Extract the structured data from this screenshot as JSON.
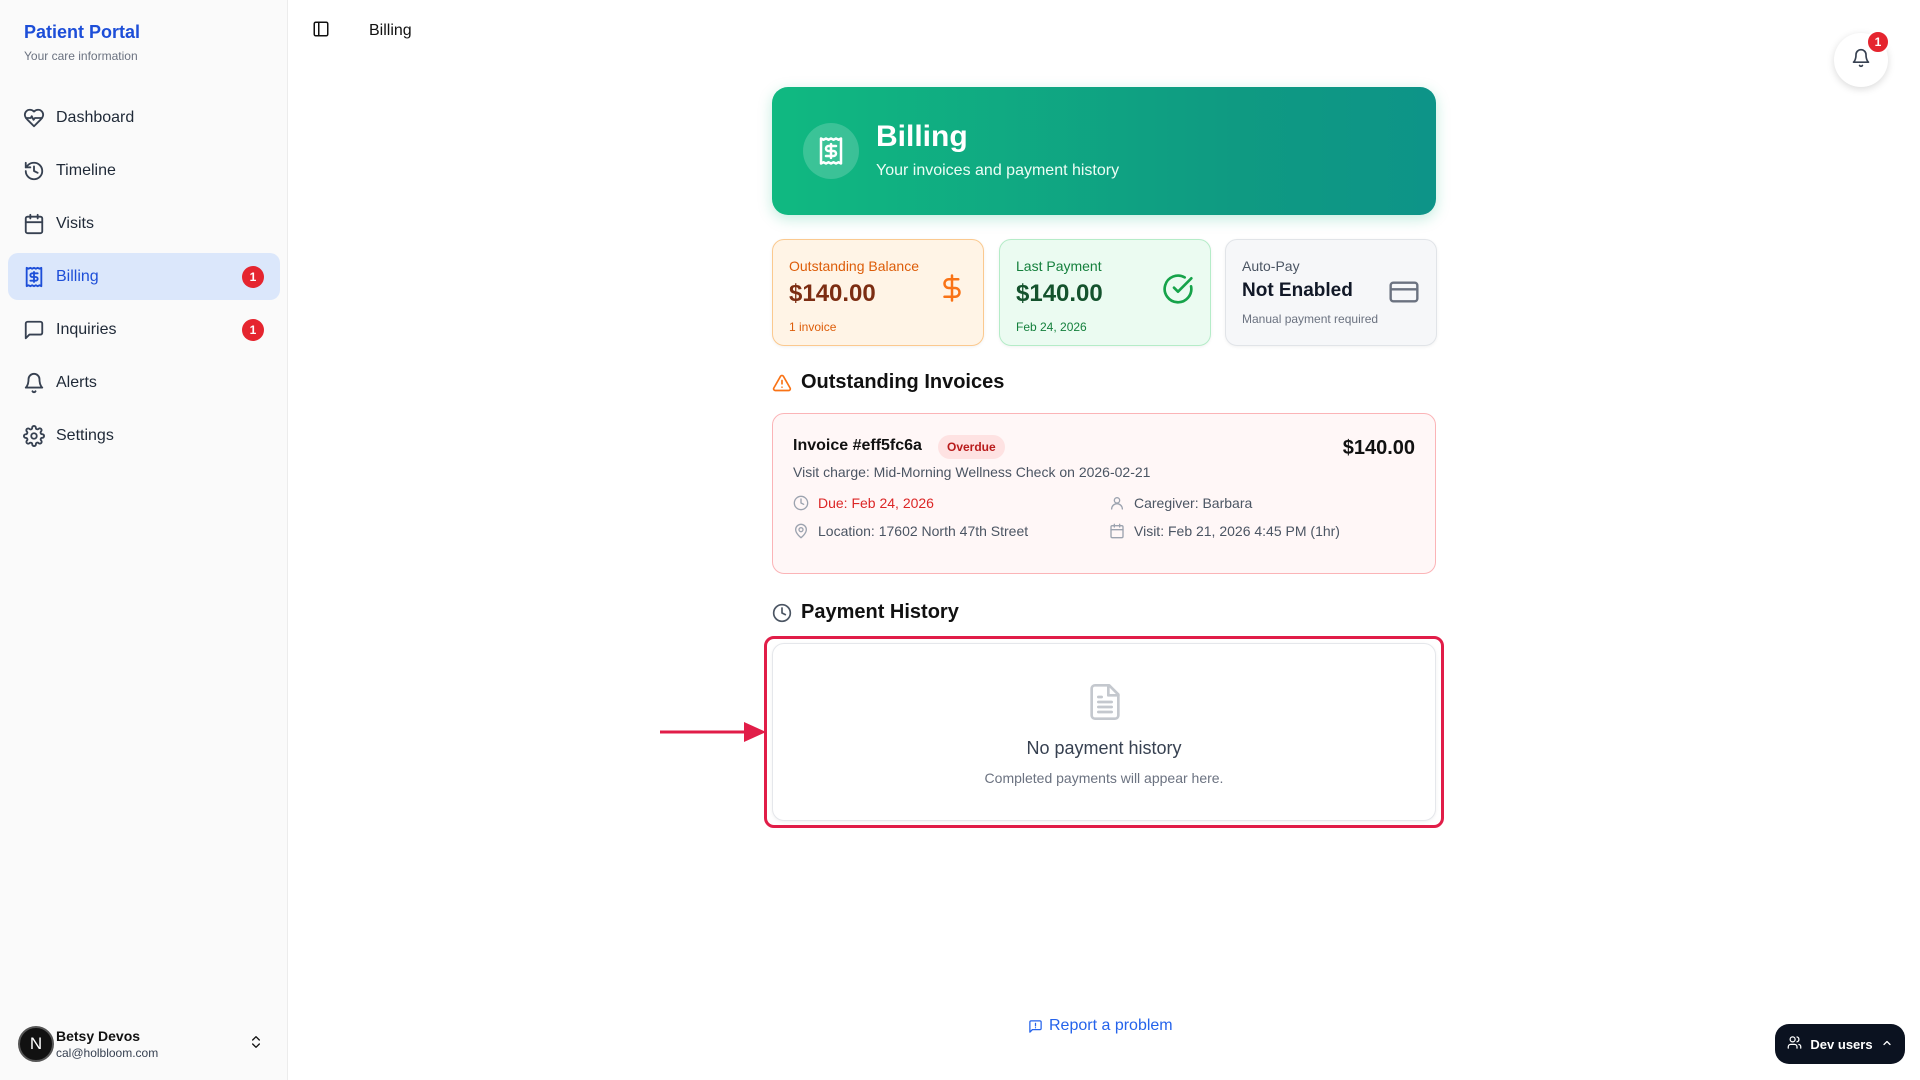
{
  "sidebar": {
    "brand_title": "Patient Portal",
    "brand_sub": "Your care information",
    "items": [
      {
        "label": "Dashboard",
        "icon": "heart-pulse-icon"
      },
      {
        "label": "Timeline",
        "icon": "history-icon"
      },
      {
        "label": "Visits",
        "icon": "calendar-icon"
      },
      {
        "label": "Billing",
        "icon": "receipt-icon",
        "badge": "1",
        "active": true
      },
      {
        "label": "Inquiries",
        "icon": "message-square-icon",
        "badge": "1"
      },
      {
        "label": "Alerts",
        "icon": "bell-icon"
      },
      {
        "label": "Settings",
        "icon": "gear-icon"
      }
    ],
    "user": {
      "avatar": "N",
      "name": "Betsy Devos",
      "email": "cal@holbloom.com"
    }
  },
  "topbar": {
    "title": "Billing",
    "notifications_count": "1"
  },
  "hero": {
    "title": "Billing",
    "subtitle": "Your invoices and payment history"
  },
  "stats": {
    "balance": {
      "label": "Outstanding Balance",
      "value": "$140.00",
      "note": "1 invoice"
    },
    "last_payment": {
      "label": "Last Payment",
      "value": "$140.00",
      "note": "Feb 24, 2026"
    },
    "auto_pay": {
      "label": "Auto-Pay",
      "value": "Not Enabled",
      "note": "Manual payment required"
    }
  },
  "invoices": {
    "heading": "Outstanding Invoices",
    "items": [
      {
        "title": "Invoice #eff5fc6a",
        "status": "Overdue",
        "amount": "$140.00",
        "description": "Visit charge: Mid-Morning Wellness Check on 2026-02-21",
        "due": "Due: Feb 24, 2026",
        "caregiver": "Caregiver: Barbara",
        "location": "Location: 17602 North 47th Street",
        "visit": "Visit: Feb 21, 2026 4:45 PM (1hr)"
      }
    ]
  },
  "history": {
    "heading": "Payment History",
    "empty_title": "No payment history",
    "empty_sub": "Completed payments will appear here."
  },
  "footer": {
    "report": "Report a problem",
    "dev_users": "Dev users"
  },
  "colors": {
    "brand": "#1d4ed8",
    "hero_start": "#10b981",
    "hero_end": "#0d9488",
    "highlight": "#e11d48",
    "badge": "#e5252f"
  }
}
